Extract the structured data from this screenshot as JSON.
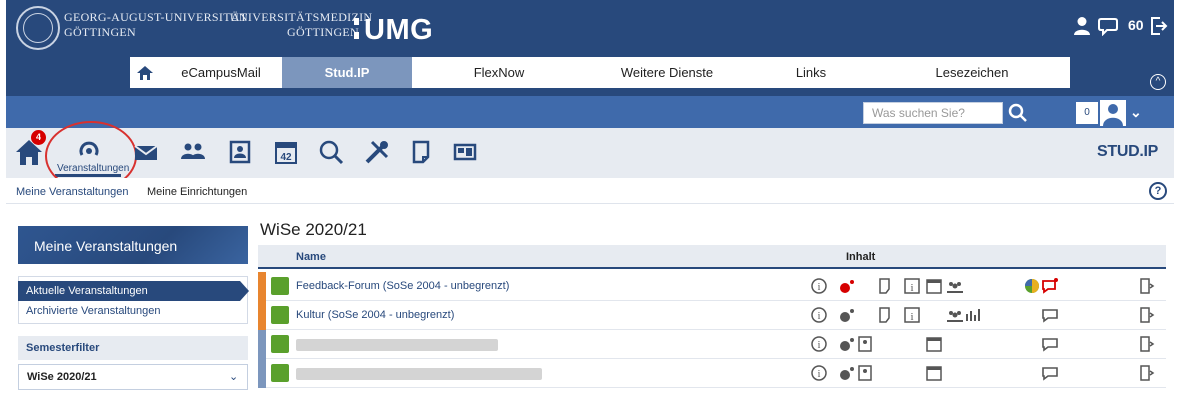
{
  "header": {
    "uni_line1": "GEORG-AUGUST-UNIVERSITÄT",
    "uni_line2": "GÖTTINGEN",
    "med_line1": "UNIVERSITÄTSMEDIZIN",
    "med_line2": "GÖTTINGEN",
    "umg": "UMG",
    "notification_count": "60"
  },
  "mainnav": {
    "items": [
      {
        "label": "eCampusMail"
      },
      {
        "label": "Stud.IP"
      },
      {
        "label": "FlexNow"
      },
      {
        "label": "Weitere Dienste"
      },
      {
        "label": "Links"
      },
      {
        "label": "Lesezeichen"
      }
    ],
    "collapse": "^"
  },
  "searchbar": {
    "placeholder": "Was suchen Sie?",
    "counter": "0"
  },
  "iconnav": {
    "badge": "4",
    "active_label": "Veranstaltungen",
    "icons": [
      "home-icon",
      "courses-icon",
      "mail-icon",
      "community-icon",
      "profile-icon",
      "calendar-icon",
      "search-icon",
      "tools-icon",
      "files-icon",
      "dashboard-icon"
    ],
    "brand": "STUD.IP"
  },
  "subnav": {
    "item1": "Meine Veranstaltungen",
    "item2": "Meine Einrichtungen",
    "help": "?"
  },
  "sidebar": {
    "title": "Meine Veranstaltungen",
    "items": [
      {
        "label": "Aktuelle Veranstaltungen"
      },
      {
        "label": "Archivierte Veranstaltungen"
      }
    ],
    "filter_title": "Semesterfilter",
    "filter_value": "WiSe 2020/21"
  },
  "main": {
    "semester": "WiSe 2020/21",
    "col_name": "Name",
    "col_inhalt": "Inhalt",
    "rows": [
      {
        "title": "Feedback-Forum (SoSe 2004 - unbegrenzt)",
        "stripe": "#e8852f"
      },
      {
        "title": "Kultur (SoSe 2004 - unbegrenzt)",
        "stripe": "#e8852f"
      },
      {
        "title": "",
        "stripe": "#7c96bd"
      },
      {
        "title": "",
        "stripe": "#7c96bd"
      }
    ]
  },
  "colors": {
    "header": "#28497c",
    "bar": "#3f6aab",
    "active_nav": "#7c96bd",
    "course_icon": "#5aa02c",
    "highlight_red": "#d8312f"
  }
}
